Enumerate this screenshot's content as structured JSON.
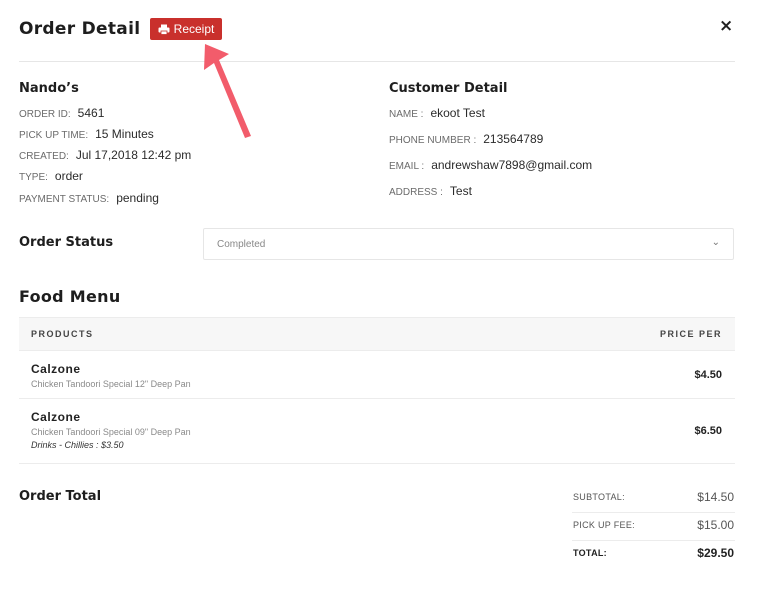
{
  "header": {
    "title": "Order Detail",
    "receipt_label": "Receipt",
    "close_label": "×"
  },
  "order": {
    "shop_name": "Nando’s",
    "fields": [
      {
        "label": "ORDER ID:",
        "value": "5461"
      },
      {
        "label": "PICK UP TIME:",
        "value": "15 Minutes"
      },
      {
        "label": "CREATED:",
        "value": "Jul 17,2018 12:42 pm"
      },
      {
        "label": "TYPE:",
        "value": "order"
      },
      {
        "label": "PAYMENT STATUS:",
        "value": "pending"
      }
    ]
  },
  "customer": {
    "title": "Customer Detail",
    "fields": [
      {
        "label": "NAME :",
        "value": "ekoot Test"
      },
      {
        "label": "PHONE NUMBER :",
        "value": "213564789"
      },
      {
        "label": "EMAIL :",
        "value": "andrewshaw7898@gmail.com"
      },
      {
        "label": "ADDRESS :",
        "value": "Test"
      }
    ]
  },
  "status": {
    "title": "Order Status",
    "selected": "Completed"
  },
  "food_menu": {
    "title": "Food Menu",
    "columns": [
      "PRODUCTS",
      "PRICE PER"
    ],
    "items": [
      {
        "name": "Calzone",
        "description": "Chicken Tandoori Special 12\" Deep Pan",
        "extra": "",
        "price": "$4.50"
      },
      {
        "name": "Calzone",
        "description": "Chicken Tandoori Special 09\" Deep Pan",
        "extra": "Drinks - Chillies : $3.50",
        "price": "$6.50"
      }
    ]
  },
  "totals": {
    "title": "Order Total",
    "lines": [
      {
        "label": "SUBTOTAL:",
        "value": "$14.50"
      },
      {
        "label": "PICK UP FEE:",
        "value": "$15.00"
      },
      {
        "label": "TOTAL:",
        "value": "$29.50"
      }
    ]
  },
  "colors": {
    "accent": "#c9302c",
    "arrow": "#f25c6b"
  }
}
